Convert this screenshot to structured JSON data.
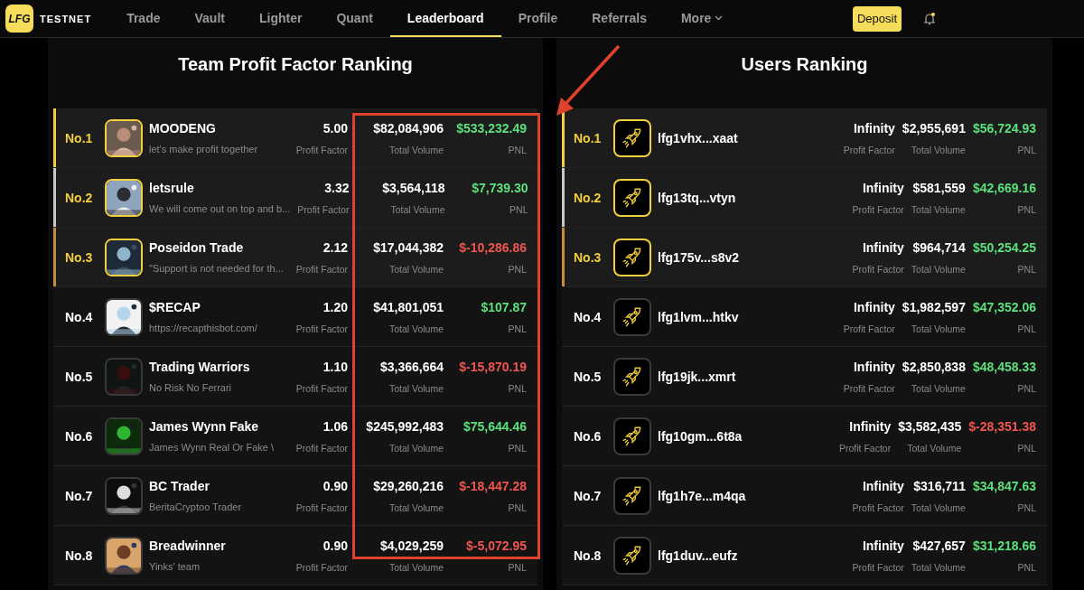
{
  "nav": {
    "logo_text": "LFG",
    "brand": "TESTNET",
    "tabs": [
      {
        "label": "Trade",
        "selected": false
      },
      {
        "label": "Vault",
        "selected": false
      },
      {
        "label": "Lighter",
        "selected": false
      },
      {
        "label": "Quant",
        "selected": false
      },
      {
        "label": "Leaderboard",
        "selected": true
      },
      {
        "label": "Profile",
        "selected": false
      },
      {
        "label": "Referrals",
        "selected": false
      },
      {
        "label": "More",
        "selected": false,
        "has_menu": true
      }
    ],
    "deposit": "Deposit"
  },
  "panels": [
    {
      "title": "Team Profit Factor Ranking",
      "kind": "team",
      "rows": [
        {
          "rank": "No.1",
          "highlighted": true,
          "color": "#f2cf3d",
          "name": "MOODENG",
          "subtitle": "let's make profit together",
          "negative": false,
          "stats": [
            {
              "value": "5.00",
              "label": "Profit Factor"
            },
            {
              "value": "$82,084,906",
              "label": "Total Volume"
            },
            {
              "value": "$533,232.49",
              "label": "PNL"
            }
          ]
        },
        {
          "rank": "No.2",
          "highlighted": true,
          "color": "#c8c8c8",
          "name": "letsrule",
          "subtitle": "We will come out on top and b...",
          "negative": false,
          "stats": [
            {
              "value": "3.32",
              "label": "Profit Factor"
            },
            {
              "value": "$3,564,118",
              "label": "Total Volume"
            },
            {
              "value": "$7,739.30",
              "label": "PNL"
            }
          ]
        },
        {
          "rank": "No.3",
          "highlighted": true,
          "color": "#c98a3c",
          "name": "Poseidon Trade",
          "subtitle": "\"Support is not needed for th...",
          "negative": true,
          "stats": [
            {
              "value": "2.12",
              "label": "Profit Factor"
            },
            {
              "value": "$17,044,382",
              "label": "Total Volume"
            },
            {
              "value": "$-10,286.86",
              "label": "PNL"
            }
          ]
        },
        {
          "rank": "No.4",
          "highlighted": false,
          "name": "$RECAP",
          "subtitle": "https://recapthisbot.com/",
          "negative": false,
          "stats": [
            {
              "value": "1.20",
              "label": "Profit Factor"
            },
            {
              "value": "$41,801,051",
              "label": "Total Volume"
            },
            {
              "value": "$107.87",
              "label": "PNL"
            }
          ]
        },
        {
          "rank": "No.5",
          "highlighted": false,
          "name": "Trading Warriors",
          "subtitle": "No Risk No Ferrari",
          "negative": true,
          "stats": [
            {
              "value": "1.10",
              "label": "Profit Factor"
            },
            {
              "value": "$3,366,664",
              "label": "Total Volume"
            },
            {
              "value": "$-15,870.19",
              "label": "PNL"
            }
          ]
        },
        {
          "rank": "No.6",
          "highlighted": false,
          "name": "James Wynn Fake",
          "subtitle": "James Wynn Real Or Fake \\",
          "negative": false,
          "stats": [
            {
              "value": "1.06",
              "label": "Profit Factor"
            },
            {
              "value": "$245,992,483",
              "label": "Total Volume"
            },
            {
              "value": "$75,644.46",
              "label": "PNL"
            }
          ]
        },
        {
          "rank": "No.7",
          "highlighted": false,
          "name": "BC Trader",
          "subtitle": "BeritaCryptoo Trader",
          "negative": true,
          "stats": [
            {
              "value": "0.90",
              "label": "Profit Factor"
            },
            {
              "value": "$29,260,216",
              "label": "Total Volume"
            },
            {
              "value": "$-18,447.28",
              "label": "PNL"
            }
          ]
        },
        {
          "rank": "No.8",
          "highlighted": false,
          "name": "Breadwinner",
          "subtitle": "Yinks' team",
          "negative": true,
          "stats": [
            {
              "value": "0.90",
              "label": "Profit Factor"
            },
            {
              "value": "$4,029,259",
              "label": "Total Volume"
            },
            {
              "value": "$-5,072.95",
              "label": "PNL"
            }
          ]
        }
      ]
    },
    {
      "title": "Users Ranking",
      "kind": "user",
      "rows": [
        {
          "rank": "No.1",
          "highlighted": true,
          "color": "#f2cf3d",
          "name": "lfg1vhx...xaat",
          "negative": false,
          "stats": [
            {
              "value": "Infinity",
              "label": "Profit Factor"
            },
            {
              "value": "$2,955,691",
              "label": "Total Volume"
            },
            {
              "value": "$56,724.93",
              "label": "PNL"
            }
          ]
        },
        {
          "rank": "No.2",
          "highlighted": true,
          "color": "#c8c8c8",
          "name": "lfg13tq...vtyn",
          "negative": false,
          "stats": [
            {
              "value": "Infinity",
              "label": "Profit Factor"
            },
            {
              "value": "$581,559",
              "label": "Total Volume"
            },
            {
              "value": "$42,669.16",
              "label": "PNL"
            }
          ]
        },
        {
          "rank": "No.3",
          "highlighted": true,
          "color": "#c98a3c",
          "name": "lfg175v...s8v2",
          "negative": false,
          "stats": [
            {
              "value": "Infinity",
              "label": "Profit Factor"
            },
            {
              "value": "$964,714",
              "label": "Total Volume"
            },
            {
              "value": "$50,254.25",
              "label": "PNL"
            }
          ]
        },
        {
          "rank": "No.4",
          "highlighted": false,
          "name": "lfg1lvm...htkv",
          "negative": false,
          "stats": [
            {
              "value": "Infinity",
              "label": "Profit Factor"
            },
            {
              "value": "$1,982,597",
              "label": "Total Volume"
            },
            {
              "value": "$47,352.06",
              "label": "PNL"
            }
          ]
        },
        {
          "rank": "No.5",
          "highlighted": false,
          "name": "lfg19jk...xmrt",
          "negative": false,
          "stats": [
            {
              "value": "Infinity",
              "label": "Profit Factor"
            },
            {
              "value": "$2,850,838",
              "label": "Total Volume"
            },
            {
              "value": "$48,458.33",
              "label": "PNL"
            }
          ]
        },
        {
          "rank": "No.6",
          "highlighted": false,
          "name": "lfg10gm...6t8a",
          "negative": true,
          "stats": [
            {
              "value": "Infinity",
              "label": "Profit Factor"
            },
            {
              "value": "$3,582,435",
              "label": "Total Volume"
            },
            {
              "value": "$-28,351.38",
              "label": "PNL"
            }
          ]
        },
        {
          "rank": "No.7",
          "highlighted": false,
          "name": "lfg1h7e...m4qa",
          "negative": false,
          "stats": [
            {
              "value": "Infinity",
              "label": "Profit Factor"
            },
            {
              "value": "$316,711",
              "label": "Total Volume"
            },
            {
              "value": "$34,847.63",
              "label": "PNL"
            }
          ]
        },
        {
          "rank": "No.8",
          "highlighted": false,
          "name": "lfg1duv...eufz",
          "negative": false,
          "stats": [
            {
              "value": "Infinity",
              "label": "Profit Factor"
            },
            {
              "value": "$427,657",
              "label": "Total Volume"
            },
            {
              "value": "$31,218.66",
              "label": "PNL"
            }
          ]
        }
      ]
    }
  ],
  "annotation": {
    "kind": "highlight"
  }
}
